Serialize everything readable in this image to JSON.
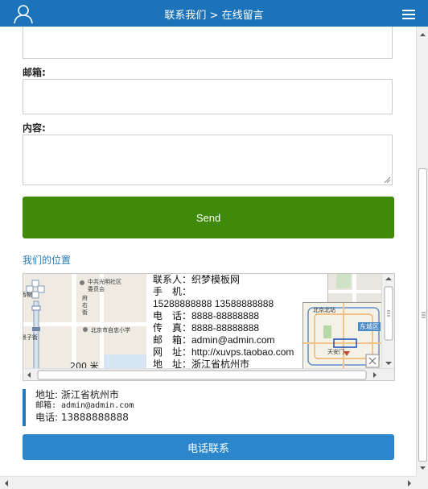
{
  "header": {
    "title": "联系我们 > 在线留言"
  },
  "form": {
    "email_label": "邮箱:",
    "content_label": "内容:",
    "send_label": "Send"
  },
  "location": {
    "title": "我们的位置"
  },
  "map": {
    "info_lines": [
      "联系人：织梦模板网",
      "手　机：",
      "15288888888 13588888888",
      "电　话：8888-88888888",
      "传　真：8888-88888888",
      "邮　箱：admin@admin.com",
      "网　址：http://xuvps.taobao.com",
      "地　址：浙江省杭州市"
    ],
    "labels": {
      "poi1": "中共光明社区委员会",
      "poi2": "北京市自忠小学",
      "street": "府右街",
      "scale": "200 米",
      "mini_district": "东城区",
      "mini_north": "北京北站",
      "mini_gate": "天安门"
    }
  },
  "address": {
    "addr": "地址: 浙江省杭州市",
    "email": "邮箱: admin@admin.com",
    "phone": "电话: 13888888888"
  },
  "call": {
    "label": "电话联系"
  },
  "colors": {
    "header_bg": "#1c73b9",
    "send_bg": "#3f8a08",
    "call_bg": "#2b86cc",
    "accent": "#1f7bc1"
  }
}
